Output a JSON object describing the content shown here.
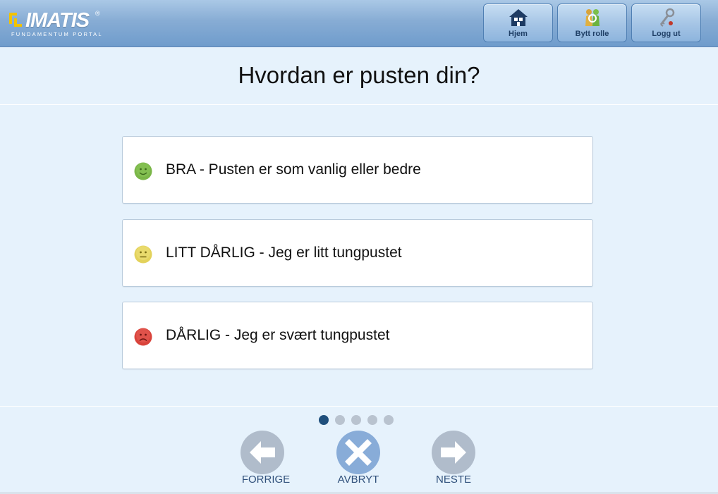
{
  "header": {
    "logo_text": "IMATIS",
    "logo_reg": "®",
    "logo_subtitle": "FUNDAMENTUM PORTAL",
    "buttons": [
      {
        "label": "Hjem",
        "icon": "home-icon"
      },
      {
        "label": "Bytt rolle",
        "icon": "switch-role-icon"
      },
      {
        "label": "Logg ut",
        "icon": "key-icon"
      }
    ]
  },
  "question": "Hvordan er pusten din?",
  "options": [
    {
      "label": "BRA - Pusten er som vanlig eller bedre",
      "icon": "happy-face-icon",
      "color": "#7ab648"
    },
    {
      "label": "LITT DÅRLIG - Jeg er litt tungpustet",
      "icon": "neutral-face-icon",
      "color": "#e3d25b"
    },
    {
      "label": "DÅRLIG - Jeg er svært tungpustet",
      "icon": "sad-face-icon",
      "color": "#d9433b"
    }
  ],
  "progress": {
    "total": 5,
    "current": 1
  },
  "nav": {
    "previous_label": "FORRIGE",
    "cancel_label": "AVBRYT",
    "next_label": "NESTE"
  },
  "colors": {
    "accent": "#1f4f7c",
    "background": "#e6f2fc",
    "cancel_button": "#88acd8",
    "disabled_button": "#b0bccb"
  }
}
